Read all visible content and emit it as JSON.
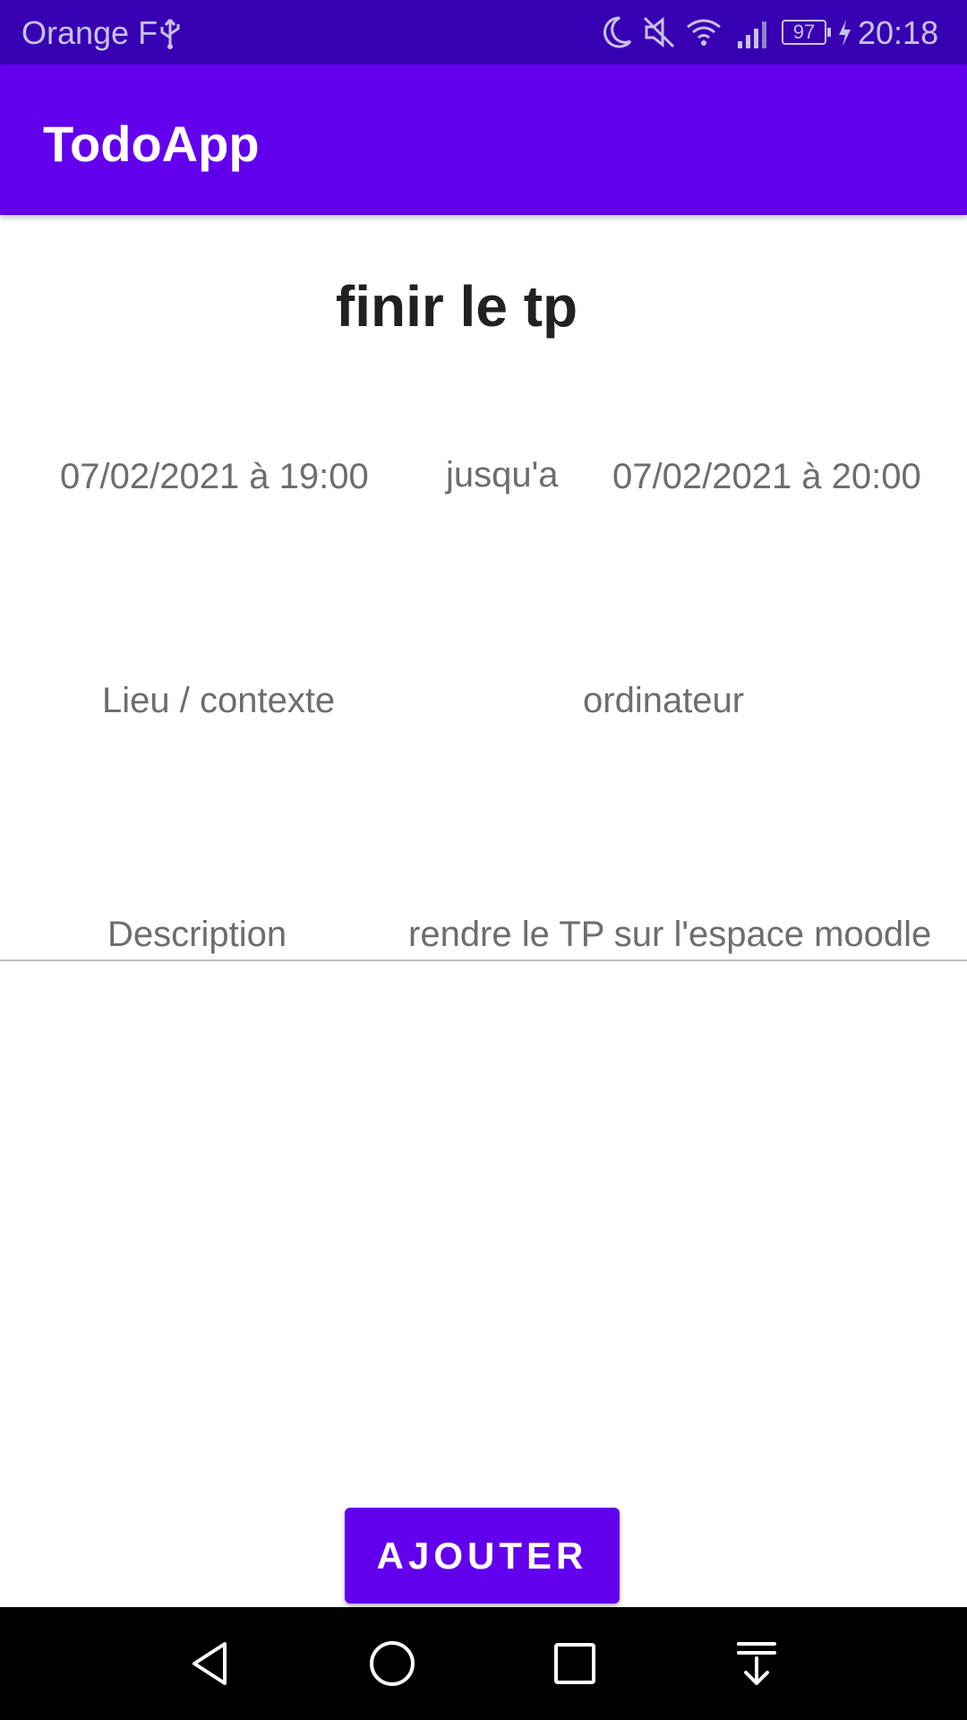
{
  "status_bar": {
    "carrier": "Orange F",
    "battery": "97",
    "time": "20:18",
    "icons": [
      "usb-icon",
      "moon-icon",
      "mute-icon",
      "wifi-icon",
      "signal-icon",
      "battery-icon",
      "charging-icon"
    ]
  },
  "app_bar": {
    "title": "TodoApp"
  },
  "task": {
    "title": "finir le tp",
    "start": "07/02/2021 à 19:00",
    "until_label": "jusqu'a",
    "end": "07/02/2021 à 20:00",
    "location_label": "Lieu /  contexte",
    "location_value": "ordinateur",
    "description_label": "Description",
    "description_value": "rendre le TP sur l'espace moodle"
  },
  "actions": {
    "add_label": "AJOUTER"
  },
  "nav_bar": {
    "icons": [
      "back-icon",
      "home-icon",
      "recents-icon",
      "notification-pull-icon"
    ]
  },
  "colors": {
    "primary": "#6200ee",
    "primary_dark": "#3700b3",
    "text_secondary": "#6d6d6d"
  }
}
